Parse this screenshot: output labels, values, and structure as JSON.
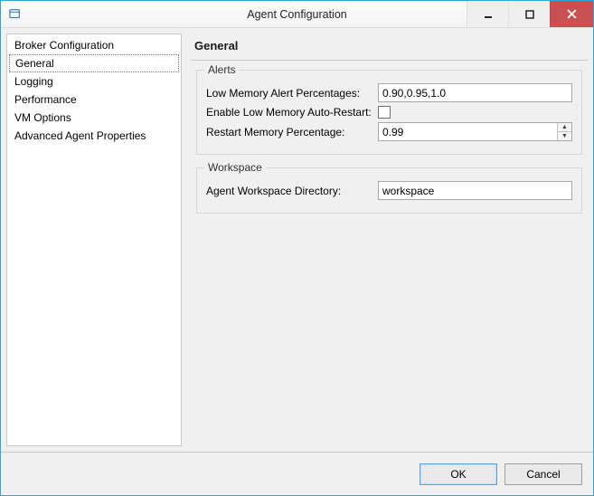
{
  "window": {
    "title": "Agent Configuration"
  },
  "sidebar": {
    "items": [
      {
        "label": "Broker Configuration",
        "selected": false
      },
      {
        "label": "General",
        "selected": true
      },
      {
        "label": "Logging",
        "selected": false
      },
      {
        "label": "Performance",
        "selected": false
      },
      {
        "label": "VM Options",
        "selected": false
      },
      {
        "label": "Advanced Agent Properties",
        "selected": false
      }
    ]
  },
  "header": {
    "title": "General"
  },
  "alerts": {
    "legend": "Alerts",
    "low_memory_label": "Low Memory Alert Percentages:",
    "low_memory_value": "0.90,0.95,1.0",
    "enable_auto_restart_label": "Enable Low Memory Auto-Restart:",
    "enable_auto_restart_checked": false,
    "restart_percentage_label": "Restart Memory Percentage:",
    "restart_percentage_value": "0.99"
  },
  "workspace": {
    "legend": "Workspace",
    "directory_label": "Agent Workspace Directory:",
    "directory_value": "workspace"
  },
  "footer": {
    "ok_label": "OK",
    "cancel_label": "Cancel"
  }
}
